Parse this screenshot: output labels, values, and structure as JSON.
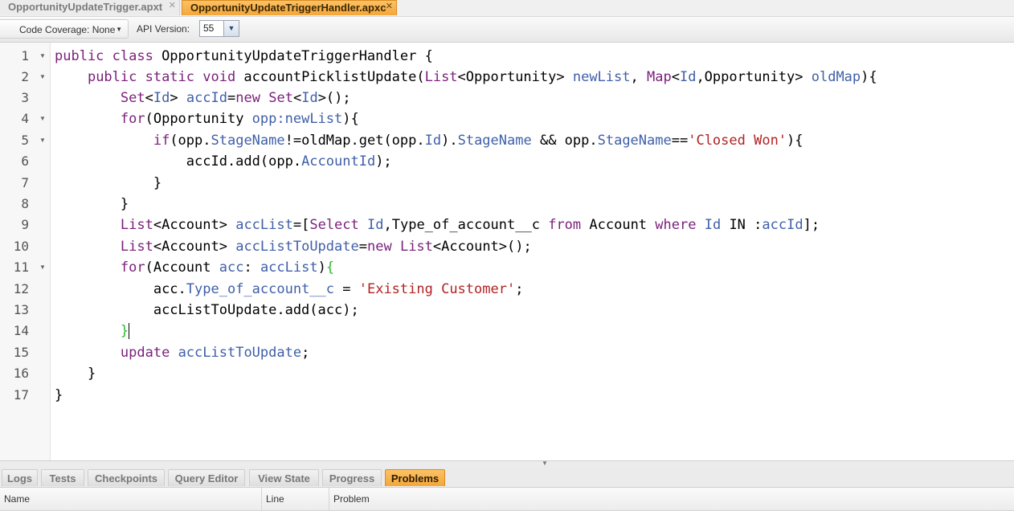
{
  "file_tabs": [
    {
      "label": "OpportunityUpdateTrigger.apxt",
      "active": false
    },
    {
      "label": "OpportunityUpdateTriggerHandler.apxc",
      "active": true
    }
  ],
  "toolbar": {
    "coverage_label": "Code Coverage: None",
    "api_label": "API Version:",
    "api_value": "55"
  },
  "editor": {
    "line_numbers": [
      "1",
      "2",
      "3",
      "4",
      "5",
      "6",
      "7",
      "8",
      "9",
      "10",
      "11",
      "12",
      "13",
      "14",
      "15",
      "16",
      "17"
    ],
    "line1": {
      "kw": "public class",
      "rest": " OpportunityUpdateTriggerHandler {"
    },
    "line2": {
      "kw": "public static void",
      "mid": " accountPicklistUpdate(",
      "t1": "List",
      "lt1": "<Opportunity> ",
      "v1": "newList",
      "comma": ", ",
      "t2": "Map",
      "lt2": "<",
      "id": "Id",
      "lt3": ",Opportunity> ",
      "v2": "oldMap",
      "end": "){"
    },
    "line3": {
      "t": "Set",
      "lt": "<",
      "id": "Id",
      "gt": "> ",
      "v": "accId",
      "eq": "=",
      "kw": "new",
      "sp": " ",
      "t2": "Set",
      "lt2": "<",
      "id2": "Id",
      "end": ">();"
    },
    "line4": {
      "kw": "for",
      "a": "(Opportunity ",
      "v": "opp:newList",
      "end": "){"
    },
    "line5": {
      "kw": "if",
      "a": "(opp.",
      "f1": "StageName",
      "b": "!=oldMap.get(opp.",
      "f2": "Id",
      "c": ").",
      "f3": "StageName",
      "d": " && opp.",
      "f4": "StageName",
      "e": "==",
      "s": "'Closed Won'",
      "end": "){"
    },
    "line6": {
      "a": "accId.add(opp.",
      "f": "AccountId",
      "end": ");"
    },
    "line7": "}",
    "line8": "}",
    "line9": {
      "t": "List",
      "a": "<Account> ",
      "v": "accList",
      "b": "=[",
      "kw1": "Select",
      "sp": " ",
      "f": "Id",
      "c": ",Type_of_account__c ",
      "kw2": "from",
      "d": " Account ",
      "kw3": "where",
      "e": " ",
      "f2": "Id",
      "g": " IN :",
      "v2": "accId",
      "end": "];"
    },
    "line10": {
      "t": "List",
      "a": "<Account> ",
      "v": "accListToUpdate",
      "eq": "=",
      "kw": "new",
      "sp": " ",
      "t2": "List",
      "end": "<Account>();"
    },
    "line11": {
      "kw": "for",
      "a": "(Account ",
      "v": "acc",
      "b": ": ",
      "v2": "accList",
      "c": ")",
      "brace": "{"
    },
    "line12": {
      "a": "acc.",
      "f": "Type_of_account__c",
      "b": " = ",
      "s": "'Existing Customer'",
      "end": ";"
    },
    "line13": "accListToUpdate.add(acc);",
    "line14": "}",
    "line15": {
      "kw": "update",
      "sp": " ",
      "v": "accListToUpdate",
      "end": ";"
    },
    "line16": "}",
    "line17": "}"
  },
  "bottom_tabs": [
    "Logs",
    "Tests",
    "Checkpoints",
    "Query Editor",
    "View State",
    "Progress",
    "Problems"
  ],
  "bottom_active_tab": "Problems",
  "problems_columns": [
    "Name",
    "Line",
    "Problem"
  ],
  "colors": {
    "active_tab": "#f4a73a",
    "keyword": "#7a1f7a",
    "property": "#3f5fa8",
    "string": "#b22222",
    "matched_brace": "#2db82d"
  }
}
